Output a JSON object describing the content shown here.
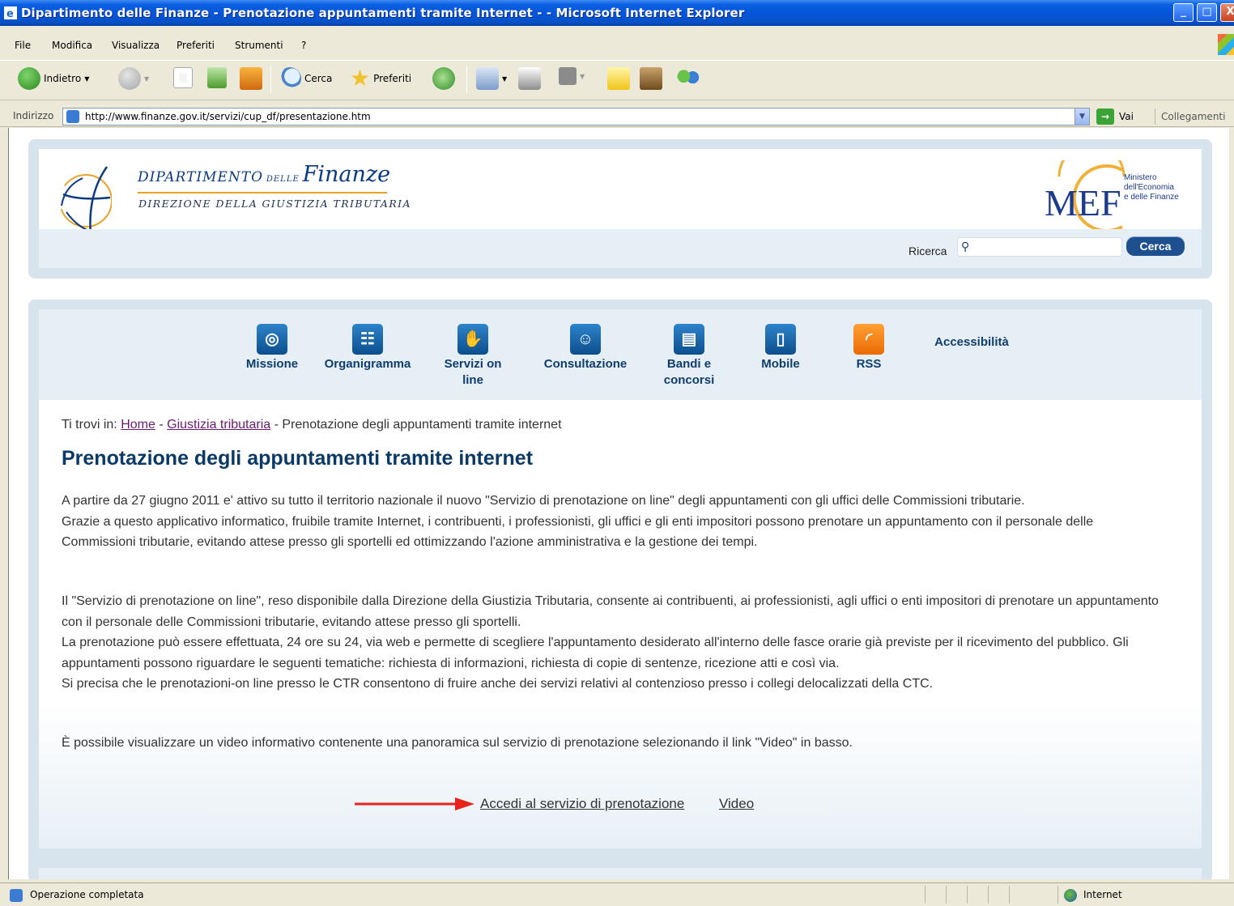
{
  "window": {
    "title": "Dipartimento delle Finanze - Prenotazione appuntamenti tramite Internet - - Microsoft Internet Explorer",
    "btn_min": "_",
    "btn_max": "□",
    "btn_close": "X"
  },
  "menu": [
    "File",
    "Modifica",
    "Visualizza",
    "Preferiti",
    "Strumenti",
    "?"
  ],
  "toolbar": {
    "back": "Indietro",
    "search": "Cerca",
    "favorites": "Preferiti"
  },
  "address": {
    "label": "Indirizzo",
    "url": "http://www.finanze.gov.it/servizi/cup_df/presentazione.htm",
    "go": "Vai",
    "links": "Collegamenti"
  },
  "header": {
    "dip_word1": "DIPARTIMENTO",
    "dip_word2": "DELLE",
    "dip_word3": "Finanze",
    "dip_sub": "DIREZIONE DELLA GIUSTIZIA TRIBUTARIA",
    "mef_logo": "MEF",
    "mef_line1": "Ministero",
    "mef_line2": "dell'Economia",
    "mef_line3": "e delle Finanze",
    "search_label": "Ricerca",
    "search_value": "",
    "search_button": "Cerca"
  },
  "nav": [
    {
      "label": "Missione",
      "icon": "target-icon"
    },
    {
      "label": "Organigramma",
      "icon": "org-chart-icon"
    },
    {
      "label": "Servizi on line",
      "icon": "hand-icon"
    },
    {
      "label": "Consultazione",
      "icon": "people-icon"
    },
    {
      "label": "Bandi e concorsi",
      "icon": "document-icon"
    },
    {
      "label": "Mobile",
      "icon": "mobile-icon"
    },
    {
      "label": "RSS",
      "icon": "rss-icon"
    },
    {
      "label": "Accessibilità"
    }
  ],
  "breadcrumb": {
    "prefix": "Ti trovi in:",
    "home": "Home",
    "sep1": "-",
    "section": "Giustizia tributaria",
    "sep2": "-",
    "current": "Prenotazione degli appuntamenti tramite internet"
  },
  "content": {
    "title": "Prenotazione degli appuntamenti tramite internet",
    "p1a": "A partire da 27 giugno 2011 e' attivo su tutto il territorio nazionale il nuovo \"Servizio di prenotazione on line\" degli appuntamenti con gli uffici delle Commissioni tributarie.",
    "p1b": "Grazie a questo applicativo informatico, fruibile tramite Internet, i contribuenti, i professionisti, gli uffici e gli enti impositori possono prenotare un appuntamento con il personale delle Commissioni tributarie, evitando attese presso gli sportelli ed ottimizzando l'azione amministrativa e la gestione dei tempi.",
    "p2a": "Il \"Servizio di prenotazione on line\", reso disponibile dalla Direzione della Giustizia Tributaria, consente ai contribuenti, ai professionisti, agli uffici o enti impositori di prenotare un appuntamento con il personale delle Commissioni tributarie, evitando attese presso gli sportelli.",
    "p2b": "La prenotazione può essere effettuata, 24 ore su 24, via web e permette di scegliere l'appuntamento desiderato all'interno delle fasce orarie già previste per il ricevimento del pubblico. Gli appuntamenti possono riguardare le seguenti tematiche: richiesta di informazioni, richiesta di copie di sentenze, ricezione atti e così via.",
    "p2c": "Si precisa che le prenotazioni-on line presso le CTR consentono di fruire anche dei servizi relativi al contenzioso presso i collegi delocalizzati della CTC.",
    "p3": "È possibile visualizzare un video informativo contenente una panoramica sul servizio di prenotazione selezionando il link \"Video\" in basso.",
    "link_access": "Accedi al servizio di prenotazione",
    "link_video": "Video"
  },
  "status": {
    "text": "Operazione completata",
    "zone": "Internet"
  },
  "colors": {
    "title_blue": "#0c3a66",
    "panel": "#d7e4ee",
    "arrow_red": "#e8231b",
    "visited_link": "#6b1b6e"
  }
}
